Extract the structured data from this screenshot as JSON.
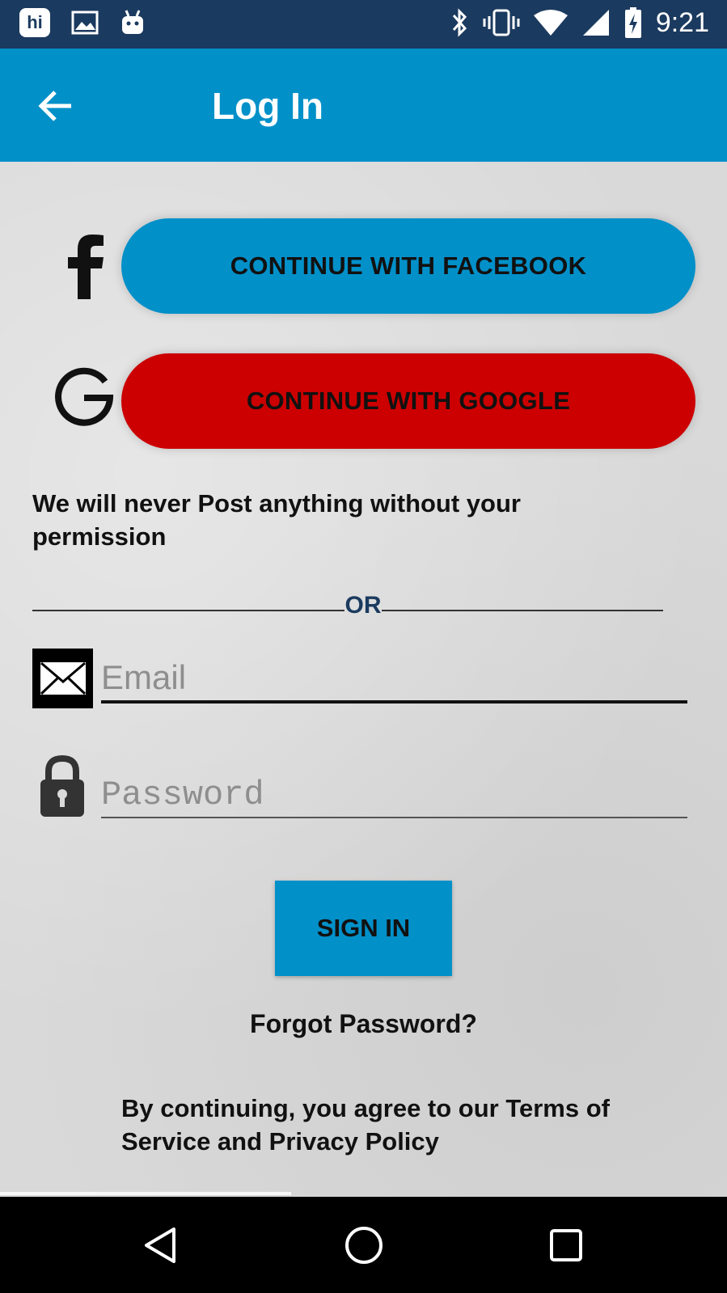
{
  "status_bar": {
    "time": "9:21",
    "app_icon_text": "hi",
    "icons": [
      "hi-app-icon",
      "gallery-icon",
      "android-icon",
      "bluetooth-icon",
      "vibrate-icon",
      "wifi-icon",
      "signal-icon",
      "battery-charging-icon"
    ]
  },
  "app_bar": {
    "title": "Log In",
    "back_icon": "arrow-back-icon"
  },
  "social": {
    "facebook_label": "CONTINUE WITH FACEBOOK",
    "google_label": "CONTINUE WITH GOOGLE",
    "facebook_color": "#0290c9",
    "google_color": "#cc0000"
  },
  "notice": "We will never Post anything without your permission",
  "divider_text": "OR",
  "form": {
    "email_placeholder": "Email",
    "password_placeholder": "Password",
    "sign_in_label": "SIGN IN",
    "forgot_label": "Forgot Password?"
  },
  "terms": "By continuing, you agree to our Terms of Service and  Privacy Policy",
  "nav_bar": {
    "icons": [
      "nav-back-icon",
      "nav-home-icon",
      "nav-recents-icon"
    ]
  },
  "colors": {
    "status_bar": "#1b3a5f",
    "accent": "#0290c9"
  }
}
